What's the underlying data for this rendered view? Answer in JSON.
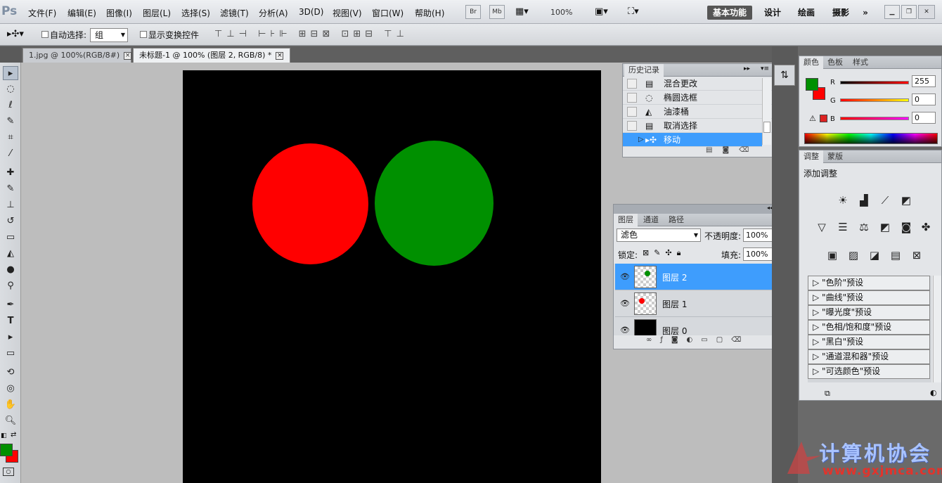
{
  "app": {
    "logo": "Ps"
  },
  "menu": [
    "文件(F)",
    "编辑(E)",
    "图像(I)",
    "图层(L)",
    "选择(S)",
    "滤镜(T)",
    "分析(A)",
    "3D(D)",
    "视图(V)",
    "窗口(W)",
    "帮助(H)"
  ],
  "app_bar": {
    "bridge": "Br",
    "mini_bridge": "Mb",
    "zoom": "100%"
  },
  "workspaces": [
    "基本功能",
    "设计",
    "绘画",
    "摄影",
    "»"
  ],
  "options": {
    "auto_select_label": "自动选择:",
    "auto_select_value": "组",
    "show_transform_label": "显示变换控件"
  },
  "doc_tabs": [
    {
      "title": "1.jpg @ 100%(RGB/8#)",
      "close": "×"
    },
    {
      "title": "未标题-1 @ 100% (图层 2, RGB/8) *",
      "close": "×"
    }
  ],
  "history": {
    "tab": "历史记录",
    "items": [
      {
        "icon": "document-icon",
        "label": "混合更改"
      },
      {
        "icon": "ellipse-marquee-icon",
        "label": "椭圆选框"
      },
      {
        "icon": "paint-bucket-icon",
        "label": "油漆桶"
      },
      {
        "icon": "document-icon",
        "label": "取消选择"
      },
      {
        "icon": "move-icon",
        "label": "移动"
      }
    ]
  },
  "layers": {
    "tabs": [
      "图层",
      "通道",
      "路径"
    ],
    "blend_mode": "滤色",
    "opacity_label": "不透明度:",
    "opacity": "100%",
    "lock_label": "锁定:",
    "fill_label": "填充:",
    "fill": "100%",
    "items": [
      {
        "name": "图层 2",
        "dot_color": "#009000",
        "selected": true
      },
      {
        "name": "图层 1",
        "dot_color": "#ff0000",
        "selected": false
      },
      {
        "name": "图层 0",
        "dot_color": "#000000",
        "selected": false
      }
    ]
  },
  "color_panel": {
    "tabs": [
      "颜色",
      "色板",
      "样式"
    ],
    "r_label": "R",
    "r": "255",
    "g_label": "G",
    "g": "0",
    "b_label": "B",
    "b": "0",
    "foreground": "#009000",
    "background": "#ff0000"
  },
  "adjust_panel": {
    "tabs": [
      "调整",
      "蒙版"
    ],
    "title": "添加调整",
    "presets": [
      "\"色阶\"预设",
      "\"曲线\"预设",
      "\"曝光度\"预设",
      "\"色相/饱和度\"预设",
      "\"黑白\"预设",
      "\"通道混和器\"预设",
      "\"可选颜色\"预设"
    ]
  },
  "canvas": {
    "background": "#000000",
    "circle1_color": "#ff0000",
    "circle2_color": "#009000"
  },
  "watermark": {
    "text": "计算机协会",
    "url": "www.gxjmca.com"
  }
}
